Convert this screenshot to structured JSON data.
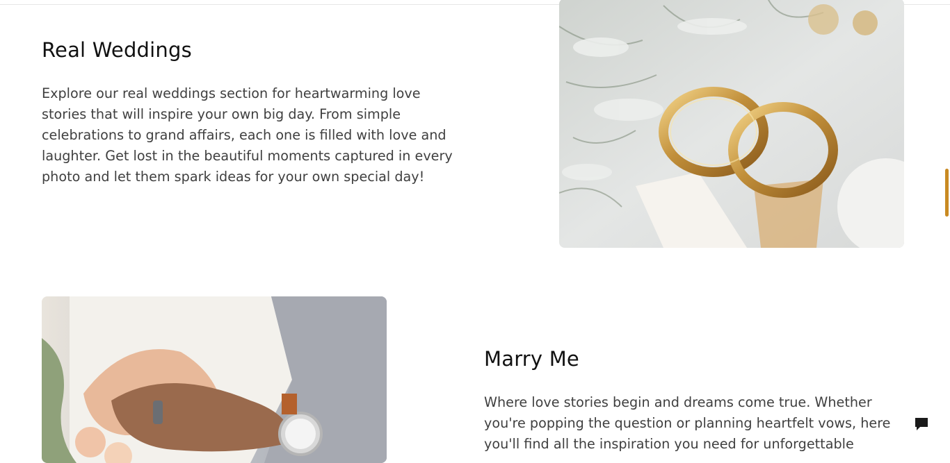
{
  "sections": {
    "real_weddings": {
      "title": "Real Weddings",
      "text": "Explore our real weddings section for heartwarming love stories that will inspire your own big day. From simple celebrations to grand affairs, each one is filled with love and laughter. Get lost in the beautiful moments captured in every photo and let them spark ideas for your own special day!",
      "image": "gold-wedding-rings-photo"
    },
    "marry_me": {
      "title": "Marry Me",
      "text": "Where love stories begin and dreams come true. Whether you're popping the question or planning heartfelt vows, here you'll find all the inspiration you need for unforgettable",
      "image": "couple-hands-with-rings-photo"
    }
  },
  "widgets": {
    "chat_icon": "chat-bubble-icon",
    "scroll_indicator_color": "#c98a22"
  }
}
